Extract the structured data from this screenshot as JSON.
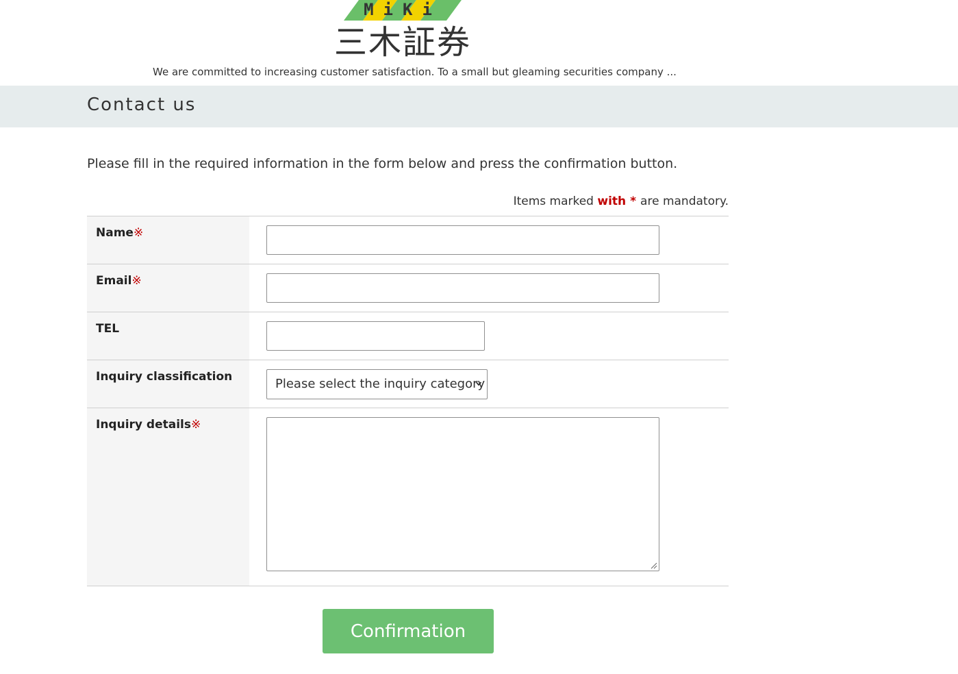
{
  "header": {
    "logo_band_text": "MiKi",
    "logo_text": "三木証券",
    "tagline": "We are committed to increasing customer satisfaction. To a small but gleaming securities company ..."
  },
  "page": {
    "title": "Contact us",
    "intro": "Please fill in the required information in the form below and press the confirmation button."
  },
  "mandatory_note": {
    "prefix": "Items marked",
    "with": "with",
    "star": "*",
    "suffix": "are mandatory."
  },
  "form": {
    "required_mark": "※",
    "name_label": "Name",
    "email_label": "Email",
    "tel_label": "TEL",
    "classification_label": "Inquiry classification",
    "classification_selected": "Please select the inquiry category",
    "details_label": "Inquiry details",
    "name_value": "",
    "email_value": "",
    "tel_value": ""
  },
  "confirm_button": "Confirmation",
  "colors": {
    "title_band": "#e6eced",
    "required": "#c00000",
    "button": "#6cc072",
    "logo_green": "#6abf69",
    "logo_yellow": "#f2d200"
  }
}
